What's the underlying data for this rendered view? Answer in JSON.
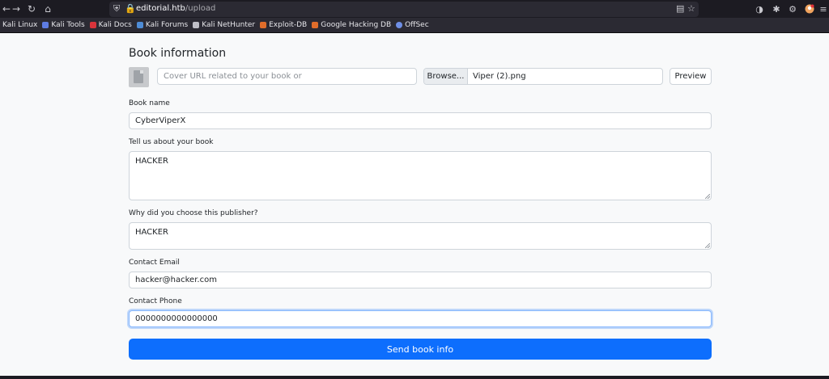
{
  "browser": {
    "url_host": "editorial.htb",
    "url_path": "/upload",
    "icons": {
      "back": "arrow-left-icon",
      "forward": "arrow-right-icon",
      "reload": "reload-icon",
      "home": "home-icon",
      "shield": "shield-icon",
      "lock": "lock-icon",
      "reader": "reader-view-icon",
      "bookmark_star": "star-icon",
      "pocket": "pocket-icon",
      "extensions": "extensions-icon",
      "settings": "gear-icon",
      "profile": "profile-icon",
      "menu": "menu-icon"
    },
    "bookmarks": [
      {
        "label": "Kali Linux",
        "icon_color": "#2b2a33"
      },
      {
        "label": "Kali Tools",
        "icon_color": "#5e7ce2"
      },
      {
        "label": "Kali Docs",
        "icon_color": "#d9343b"
      },
      {
        "label": "Kali Forums",
        "icon_color": "#4e8cd6"
      },
      {
        "label": "Kali NetHunter",
        "icon_color": "#c0c0c8"
      },
      {
        "label": "Exploit-DB",
        "icon_color": "#e06d2a"
      },
      {
        "label": "Google Hacking DB",
        "icon_color": "#e06d2a"
      },
      {
        "label": "OffSec",
        "icon_color": "#6f8fe6"
      }
    ]
  },
  "form": {
    "title": "Book information",
    "cover_url": {
      "placeholder": "Cover URL related to your book or",
      "value": ""
    },
    "file": {
      "browse_label": "Browse...",
      "file_name": "Viper (2).png"
    },
    "preview_label": "Preview",
    "book_name": {
      "label": "Book name",
      "value": "CyberViperX"
    },
    "about": {
      "label": "Tell us about your book",
      "value": "HACKER"
    },
    "why": {
      "label": "Why did you choose this publisher?",
      "value": "HACKER"
    },
    "email": {
      "label": "Contact Email",
      "value": "hacker@hacker.com"
    },
    "phone": {
      "label": "Contact Phone",
      "value": "0000000000000000"
    },
    "submit_label": "Send book info"
  },
  "colors": {
    "primary": "#0d6efd",
    "page_bg": "#f8f9fa",
    "chrome_bg": "#1c1b22",
    "focus_ring": "#86b7fe"
  }
}
